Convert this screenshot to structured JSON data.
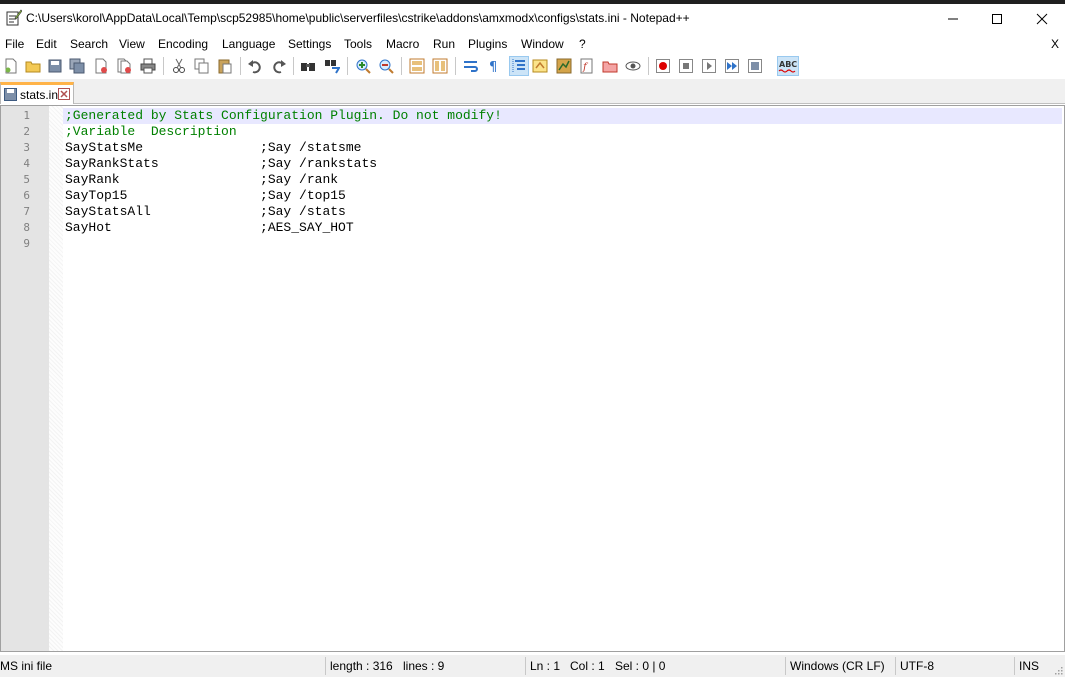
{
  "window": {
    "title": "C:\\Users\\korol\\AppData\\Local\\Temp\\scp52985\\home\\public\\serverfiles\\cstrike\\addons\\amxmodx\\configs\\stats.ini - Notepad++"
  },
  "menu": {
    "items": [
      "File",
      "Edit",
      "Search",
      "View",
      "Encoding",
      "Language",
      "Settings",
      "Tools",
      "Macro",
      "Run",
      "Plugins",
      "Window",
      "?"
    ],
    "close_label": "X"
  },
  "toolbar": {
    "icons": [
      "new-file-icon",
      "open-file-icon",
      "save-icon",
      "save-all-icon",
      "close-icon",
      "close-all-icon",
      "print-icon",
      "cut-icon",
      "copy-icon",
      "paste-icon",
      "undo-icon",
      "redo-icon",
      "find-icon",
      "replace-icon",
      "zoom-in-icon",
      "zoom-out-icon",
      "sync-vertical-icon",
      "sync-horizontal-icon",
      "word-wrap-icon",
      "show-all-characters-icon",
      "indent-guide-icon",
      "user-defined-language-icon",
      "document-map-icon",
      "function-list-icon",
      "folder-as-workspace-icon",
      "monitoring-icon",
      "record-macro-icon",
      "stop-recording-icon",
      "playback-macro-icon",
      "run-macro-multiple-icon",
      "save-macro-icon",
      "spell-check-icon"
    ],
    "spellcheck_label": "ABC"
  },
  "tab": {
    "label": "stats.ini"
  },
  "editor": {
    "lines": [
      {
        "num": "1",
        "text": ";Generated by Stats Configuration Plugin. Do not modify!",
        "kind": "comment"
      },
      {
        "num": "2",
        "text": ";Variable  Description",
        "kind": "comment"
      },
      {
        "num": "3",
        "text": "SayStatsMe               ;Say /statsme",
        "kind": "plain"
      },
      {
        "num": "4",
        "text": "SayRankStats             ;Say /rankstats",
        "kind": "plain"
      },
      {
        "num": "5",
        "text": "SayRank                  ;Say /rank",
        "kind": "plain"
      },
      {
        "num": "6",
        "text": "SayTop15                 ;Say /top15",
        "kind": "plain"
      },
      {
        "num": "7",
        "text": "SayStatsAll              ;Say /stats",
        "kind": "plain"
      },
      {
        "num": "8",
        "text": "SayHot                   ;AES_SAY_HOT",
        "kind": "plain"
      },
      {
        "num": "9",
        "text": "",
        "kind": "plain"
      }
    ]
  },
  "status": {
    "file_type": "MS ini file",
    "length": "length : 316",
    "lines": "lines : 9",
    "ln": "Ln : 1",
    "col": "Col : 1",
    "sel": "Sel : 0 | 0",
    "eol": "Windows (CR LF)",
    "encoding": "UTF-8",
    "mode": "INS"
  }
}
